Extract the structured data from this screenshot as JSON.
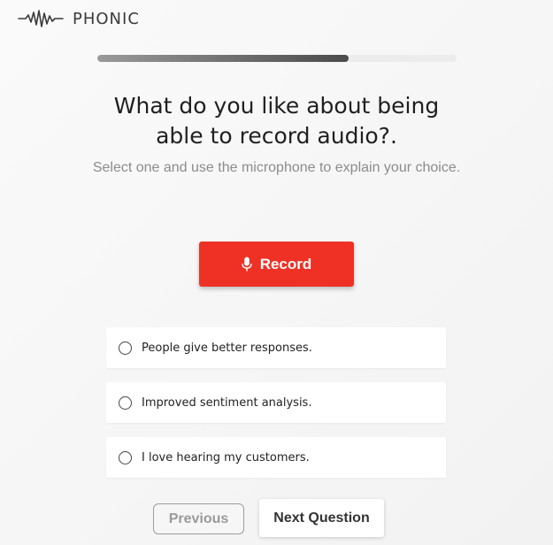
{
  "brand": {
    "name": "PHONIC",
    "logo_icon": "sound-wave-icon"
  },
  "progress": {
    "fraction": 0.7
  },
  "question": {
    "title": "What do you like about being able to record audio?.",
    "subtitle": "Select one and use the microphone to explain your choice."
  },
  "record": {
    "label": "Record",
    "icon": "microphone-icon",
    "color": "#ee3124"
  },
  "options": [
    {
      "label": "People give better responses.",
      "selected": false
    },
    {
      "label": "Improved sentiment analysis.",
      "selected": false
    },
    {
      "label": "I love hearing my customers.",
      "selected": false
    }
  ],
  "navigation": {
    "previous_label": "Previous",
    "next_label": "Next Question"
  }
}
